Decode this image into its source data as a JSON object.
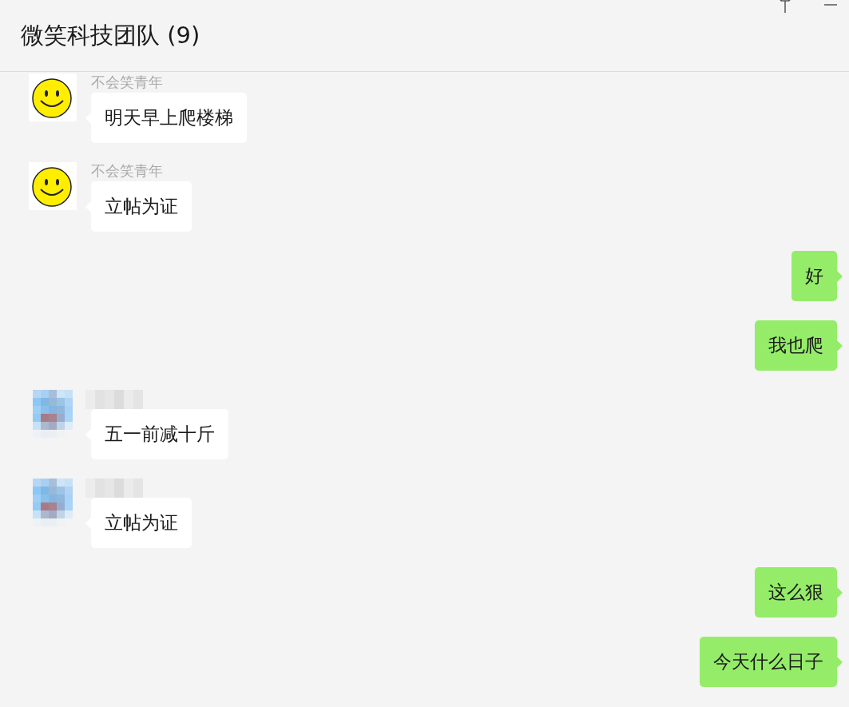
{
  "window": {
    "title": "微笑科技团队 (9)"
  },
  "messages": [
    {
      "kind": "received",
      "avatar": {
        "kind": "smiley"
      },
      "sender": "不会笑青年",
      "text": "明天早上爬楼梯"
    },
    {
      "kind": "received",
      "avatar": {
        "kind": "smiley"
      },
      "sender": "不会笑青年",
      "text": "立帖为证"
    },
    {
      "kind": "sent",
      "text": "好"
    },
    {
      "kind": "sent",
      "text": "我也爬"
    },
    {
      "kind": "received",
      "text": "五一前减十斤"
    },
    {
      "kind": "received",
      "text": "立帖为证"
    },
    {
      "kind": "sent",
      "text": "这么狠"
    },
    {
      "kind": "sent",
      "text": "今天什么日子"
    }
  ]
}
